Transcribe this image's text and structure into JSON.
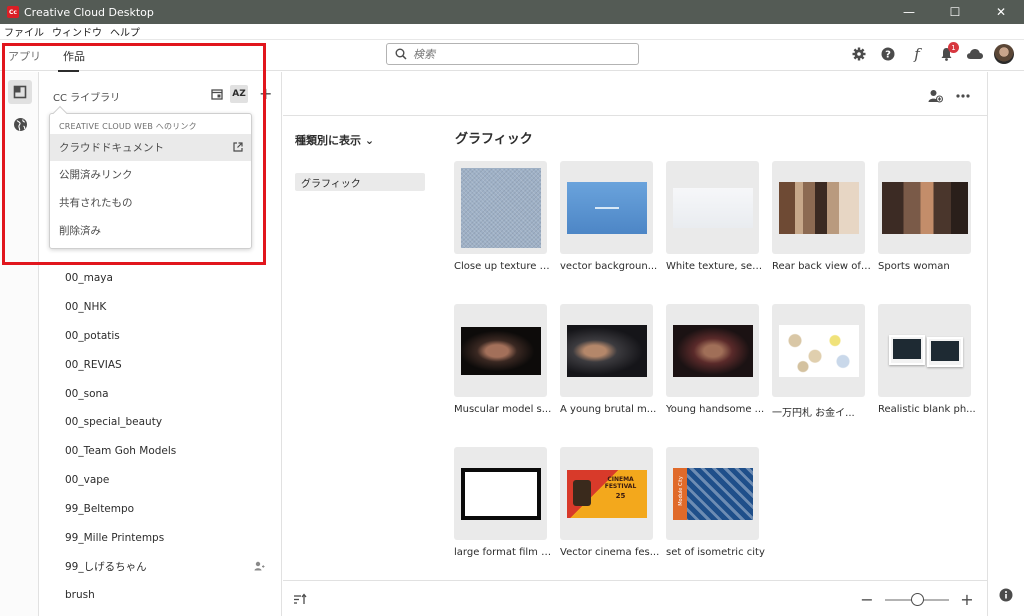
{
  "window": {
    "title": "Creative Cloud Desktop",
    "app_icon": "Cc",
    "minimize": "—",
    "maximize": "☐",
    "close": "✕"
  },
  "menubar": [
    "ファイル",
    "ウィンドウ",
    "ヘルプ"
  ],
  "topnav": {
    "apps": "アプリ",
    "work": "作品"
  },
  "search": {
    "placeholder": "検索"
  },
  "notifications": {
    "count": "1"
  },
  "library": {
    "header": "CC ライブラリ",
    "sort_icon_label": "AZ",
    "items": [
      "00_maya",
      "00_NHK",
      "00_potatis",
      "00_REVIAS",
      "00_sona",
      "00_special_beauty",
      "00_Team Goh Models",
      "00_vape",
      "99_Beltempo",
      "99_Mille Printemps",
      "99_しげるちゃん",
      "brush"
    ]
  },
  "dropdown": {
    "header": "CREATIVE CLOUD WEB へのリンク",
    "items": [
      "クラウドドキュメント",
      "公開済みリンク",
      "共有されたもの",
      "削除済み"
    ]
  },
  "filter": {
    "sort_label": "種類別に表示",
    "chevron": "⌄",
    "pill": "グラフィック"
  },
  "section": {
    "title": "グラフィック"
  },
  "assets": [
    {
      "caption": "Close up texture o..."
    },
    {
      "caption": "vector backgroun..."
    },
    {
      "caption": "White texture, sea..."
    },
    {
      "caption": "Rear back view of ..."
    },
    {
      "caption": "Sports woman"
    },
    {
      "caption": "Muscular model s..."
    },
    {
      "caption": "A young brutal m..."
    },
    {
      "caption": "Young handsome ..."
    },
    {
      "caption": "一万円札 お金イ..."
    },
    {
      "caption": "Realistic blank ph..."
    },
    {
      "caption": "large format film s..."
    },
    {
      "caption": "Vector cinema fes..."
    },
    {
      "caption": "set of isometric city"
    }
  ],
  "thumb_text": {
    "cinema": "CINEMA FESTIVAL",
    "cinema_num": "25",
    "city": "Module City"
  },
  "colors": {
    "titlebar": "#545b55",
    "accent_red": "#e1161d",
    "badge": "#d7373f"
  }
}
